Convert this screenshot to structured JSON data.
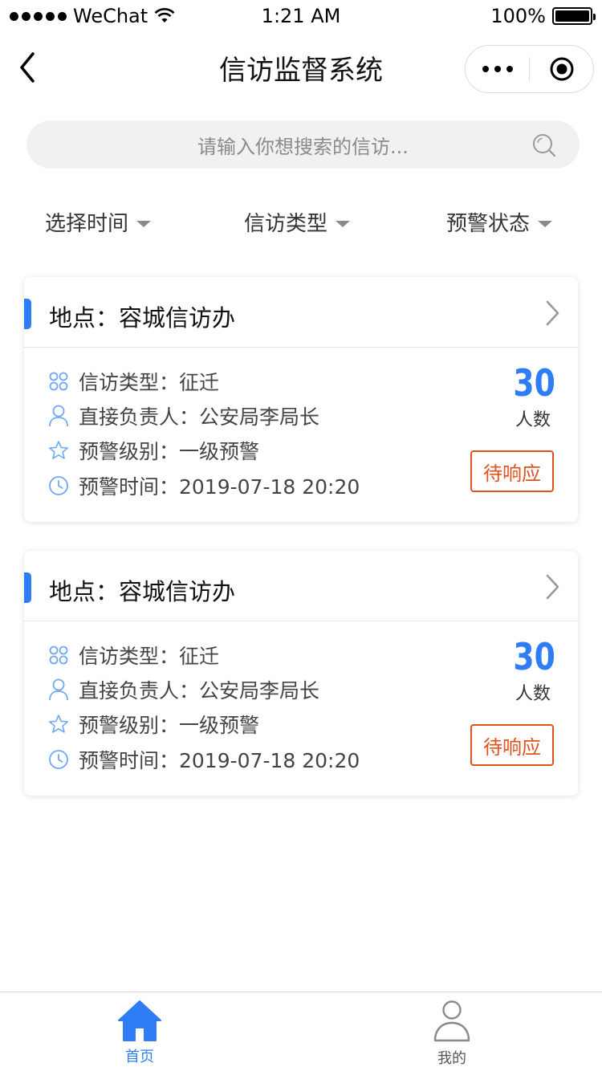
{
  "status_bar": {
    "carrier": "WeChat",
    "time": "1:21 AM",
    "battery": "100%",
    "battery_level": 1.0
  },
  "nav": {
    "title": "信访监督系统",
    "back_icon": "chevron-left-icon",
    "more_icon": "more-dots-icon",
    "close_icon": "record-circle-icon"
  },
  "search": {
    "placeholder": "请输入你想搜索的信访...",
    "icon": "search-icon"
  },
  "filters": [
    {
      "label": "选择时间"
    },
    {
      "label": "信访类型"
    },
    {
      "label": "预警状态"
    }
  ],
  "cards": [
    {
      "title": "地点：容城信访办",
      "rows": [
        {
          "icon": "grid-icon",
          "text": "信访类型：征迁"
        },
        {
          "icon": "user-icon",
          "text": "直接负责人：公安局李局长"
        },
        {
          "icon": "star-icon",
          "text": "预警级别：一级预警"
        },
        {
          "icon": "clock-icon",
          "text": "预警时间：2019-07-18  20:20"
        }
      ],
      "count": "30",
      "count_label": "人数",
      "status": "待响应"
    },
    {
      "title": "地点：容城信访办",
      "rows": [
        {
          "icon": "grid-icon",
          "text": "信访类型：征迁"
        },
        {
          "icon": "user-icon",
          "text": "直接负责人：公安局李局长"
        },
        {
          "icon": "star-icon",
          "text": "预警级别：一级预警"
        },
        {
          "icon": "clock-icon",
          "text": "预警时间：2019-07-18  20:20"
        }
      ],
      "count": "30",
      "count_label": "人数",
      "status": "待响应"
    }
  ],
  "tabs": [
    {
      "label": "首页",
      "icon": "home-icon",
      "active": true
    },
    {
      "label": "我的",
      "icon": "profile-icon",
      "active": false
    }
  ],
  "colors": {
    "accent": "#2f7df6",
    "status": "#e0531f",
    "icon": "#6ea8f5",
    "inactive": "#8a8a8a"
  }
}
